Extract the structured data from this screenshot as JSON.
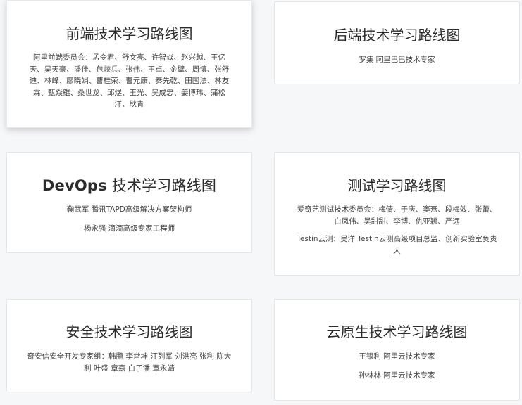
{
  "cards": [
    {
      "title": "前端技术学习路线图",
      "lines": [
        "阿里前端委员会：孟令君、舒文亮、许智焱、赵兴越、王亿天、吴天豪、潘佳、包峡兵、张伟、王卓、金擘、周慎、张舒迪、林峰、廖晓娟、曹桂荣、曹元康、秦先乾、田国法、林友霖、甄焱鲲、桑世龙、邱煜、王光、吴成忠、姜博玮、蒲松洋、耿青"
      ]
    },
    {
      "title": "后端技术学习路线图",
      "lines": [
        "罗集 阿里巴巴技术专家"
      ]
    },
    {
      "title_bold": "DevOps",
      "title_rest": " 技术学习路线图",
      "lines": [
        "鞠武军 腾讯TAPD高级解决方案架构师",
        "杨永强 滴滴高级专家工程师"
      ]
    },
    {
      "title": "测试学习路线图",
      "lines": [
        "爱奇艺测试技术委员会：梅倩、于庆、窦燕、段梅效、张蕾、白凤伟、吴甜甜、李博、仇亚颖、严远",
        "Testin云测：吴洋 Testin云测高级项目总监、创新实验室负责人"
      ]
    },
    {
      "title": "安全技术学习路线图",
      "lines": [
        "奇安信安全开发专家组：韩鹏 李常坤 汪列军 刘洪亮 张利 陈大利 叶盛 章嘉 白子潘 覃永靖"
      ]
    },
    {
      "title": "云原生技术学习路线图",
      "lines": [
        "王银利 阿里云技术专家",
        "孙林林 阿里云技术专家"
      ]
    }
  ]
}
